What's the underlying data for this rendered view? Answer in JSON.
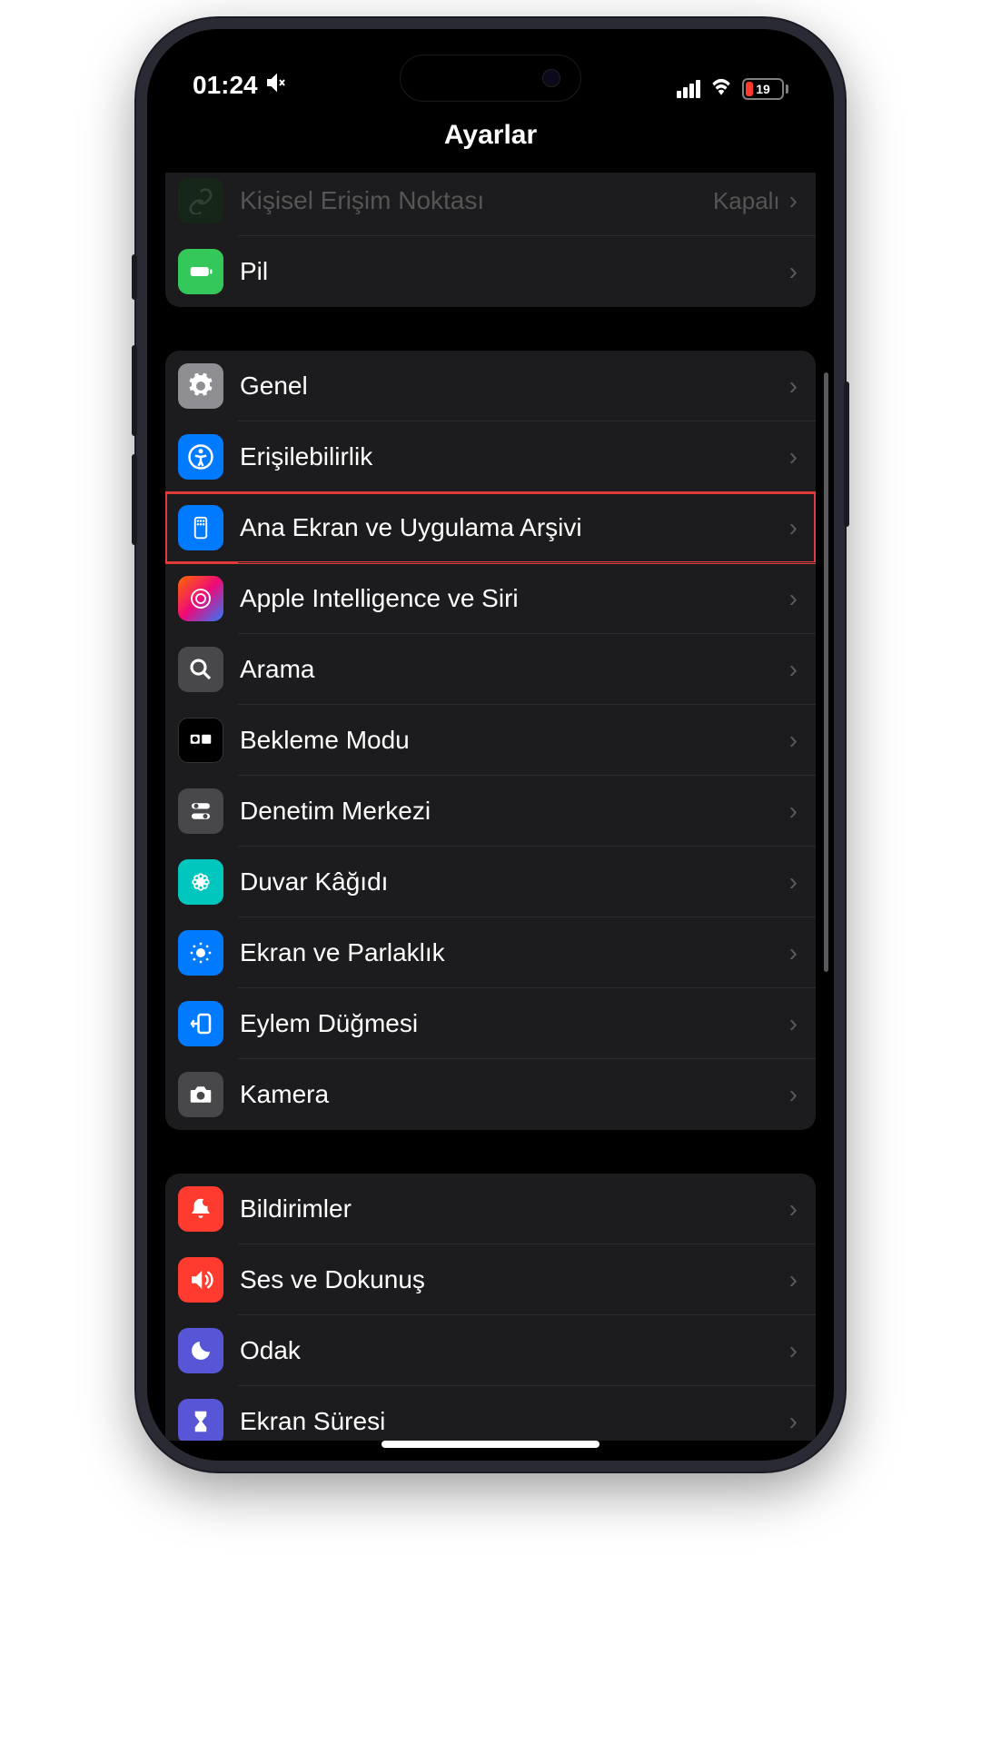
{
  "status": {
    "time": "01:24",
    "battery": "19"
  },
  "header": {
    "title": "Ayarlar"
  },
  "section1": {
    "hotspot": {
      "label": "Kişisel Erişim Noktası",
      "value": "Kapalı"
    },
    "battery": {
      "label": "Pil"
    }
  },
  "section2": {
    "general": {
      "label": "Genel"
    },
    "accessibility": {
      "label": "Erişilebilirlik"
    },
    "homescreen": {
      "label": "Ana Ekran ve Uygulama Arşivi"
    },
    "siri": {
      "label": "Apple Intelligence ve Siri"
    },
    "search": {
      "label": "Arama"
    },
    "standby": {
      "label": "Bekleme Modu"
    },
    "controlcenter": {
      "label": "Denetim Merkezi"
    },
    "wallpaper": {
      "label": "Duvar Kâğıdı"
    },
    "display": {
      "label": "Ekran ve Parlaklık"
    },
    "action": {
      "label": "Eylem Düğmesi"
    },
    "camera": {
      "label": "Kamera"
    }
  },
  "section3": {
    "notifications": {
      "label": "Bildirimler"
    },
    "sounds": {
      "label": "Ses ve Dokunuş"
    },
    "focus": {
      "label": "Odak"
    },
    "screentime": {
      "label": "Ekran Süresi"
    }
  }
}
